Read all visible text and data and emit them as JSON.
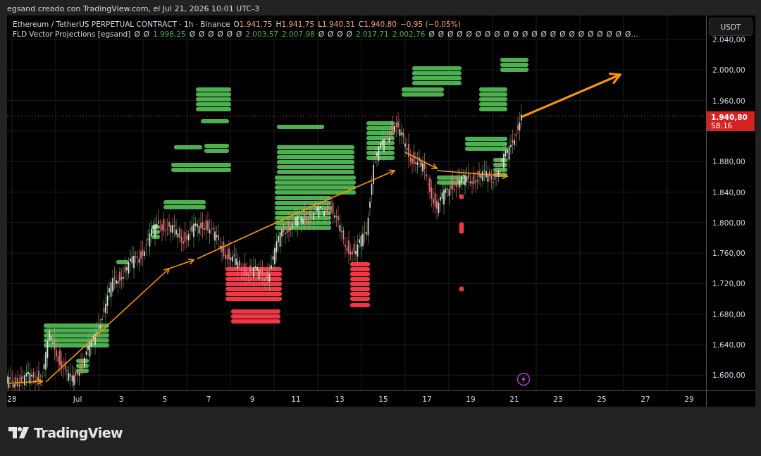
{
  "header": {
    "text": "egsand creado con TradingView.com, el Jul 21, 2026 10:01 UTC-3"
  },
  "legend": {
    "symbol": "Ethereum / TetherUS PERPETUAL CONTRACT · 1h · Binance",
    "ohlc": [
      {
        "label": "O",
        "value": "1.941,75"
      },
      {
        "label": "H",
        "value": "1.941,75"
      },
      {
        "label": "L",
        "value": "1.940,31"
      },
      {
        "label": "C",
        "value": "1.940,80"
      }
    ],
    "change": "−0,95 (−0,05%)",
    "indicator": "FLD Vector Projections [egsand]",
    "values": [
      {
        "kind": "empty",
        "text": "Ø"
      },
      {
        "kind": "empty",
        "text": "Ø"
      },
      {
        "kind": "number",
        "text": "1.998,25"
      },
      {
        "kind": "empty",
        "text": "Ø"
      },
      {
        "kind": "empty",
        "text": "Ø"
      },
      {
        "kind": "empty",
        "text": "Ø"
      },
      {
        "kind": "empty",
        "text": "Ø"
      },
      {
        "kind": "empty",
        "text": "Ø"
      },
      {
        "kind": "empty",
        "text": "Ø"
      },
      {
        "kind": "number",
        "text": "2.003,57"
      },
      {
        "kind": "number",
        "text": "2.007,98"
      },
      {
        "kind": "empty",
        "text": "Ø"
      },
      {
        "kind": "empty",
        "text": "Ø"
      },
      {
        "kind": "empty",
        "text": "Ø"
      },
      {
        "kind": "empty",
        "text": "Ø"
      },
      {
        "kind": "number",
        "text": "2.017,71"
      },
      {
        "kind": "number",
        "text": "2.002,76"
      },
      {
        "kind": "empty",
        "text": "Ø"
      },
      {
        "kind": "empty",
        "text": "Ø"
      },
      {
        "kind": "empty",
        "text": "Ø"
      },
      {
        "kind": "empty",
        "text": "Ø"
      },
      {
        "kind": "empty",
        "text": "Ø"
      },
      {
        "kind": "empty",
        "text": "Ø"
      },
      {
        "kind": "empty",
        "text": "Ø"
      },
      {
        "kind": "empty",
        "text": "Ø"
      },
      {
        "kind": "empty",
        "text": "Ø"
      },
      {
        "kind": "empty",
        "text": "Ø"
      },
      {
        "kind": "empty",
        "text": "Ø"
      },
      {
        "kind": "empty",
        "text": "Ø"
      },
      {
        "kind": "empty",
        "text": "Ø"
      },
      {
        "kind": "empty",
        "text": "Ø"
      },
      {
        "kind": "empty",
        "text": "Ø"
      },
      {
        "kind": "empty",
        "text": "Ø"
      },
      {
        "kind": "empty",
        "text": "Ø"
      },
      {
        "kind": "empty",
        "text": "Ø"
      },
      {
        "kind": "empty",
        "text": "Ø"
      },
      {
        "kind": "empty",
        "text": "Ø"
      },
      {
        "kind": "empty",
        "text": "Ø"
      },
      {
        "kind": "empty",
        "text": "Ø…"
      }
    ]
  },
  "price_axis": {
    "currency": "USDT",
    "ticks": [
      "2.040,00",
      "2.000,00",
      "1.960,00",
      "1.880,00",
      "1.840,00",
      "1.800,00",
      "1.760,00",
      "1.720,00",
      "1.680,00",
      "1.640,00",
      "1.600,00"
    ],
    "last_price": "1.940,80",
    "countdown": "58:16"
  },
  "time_axis": {
    "ticks": [
      "28",
      "Jul",
      "3",
      "5",
      "7",
      "9",
      "11",
      "13",
      "15",
      "17",
      "19",
      "21",
      "23",
      "25",
      "27",
      "29"
    ]
  },
  "footer": {
    "brand": "TradingView"
  }
}
